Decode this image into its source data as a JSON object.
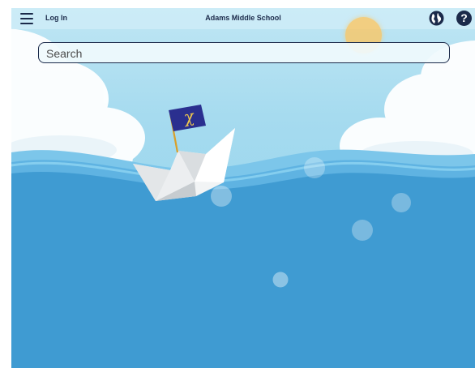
{
  "header": {
    "menu_icon": "hamburger-menu-icon",
    "login_label": "Log In",
    "school_name": "Adams Middle School",
    "globe_icon": "globe-icon",
    "help_icon": "help-icon",
    "help_glyph": "?"
  },
  "search": {
    "placeholder": "Search",
    "value": ""
  },
  "flag": {
    "logo_text": "χ"
  },
  "colors": {
    "navy": "#1b2a4a",
    "sea": "#3f9bd2",
    "sky": "#a6dbef",
    "flag": "#2a2f8f",
    "touch_indicator": "#ffc45a"
  }
}
